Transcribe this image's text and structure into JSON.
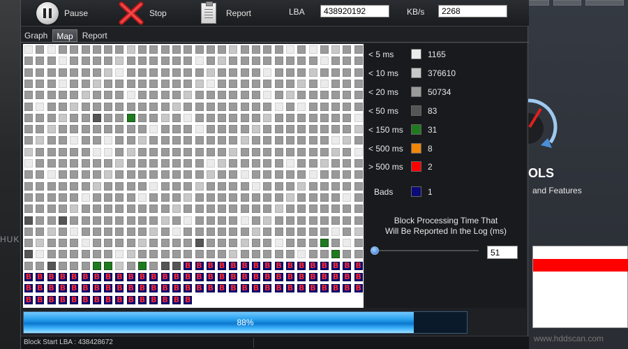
{
  "toolbar": {
    "pause_label": "Pause",
    "stop_label": "Stop",
    "report_label": "Report",
    "lba_label": "LBA",
    "lba_value": "438920192",
    "kbs_label": "KB/s",
    "kbs_value": "2268"
  },
  "tabs": [
    {
      "label": "Graph",
      "active": false
    },
    {
      "label": "Map",
      "active": true
    },
    {
      "label": "Report",
      "active": false
    }
  ],
  "legend": [
    {
      "label": "< 5 ms",
      "color": "#ebebeb",
      "count": "1165"
    },
    {
      "label": "< 10 ms",
      "color": "#c8c8c8",
      "count": "376610"
    },
    {
      "label": "< 20 ms",
      "color": "#9a9a9a",
      "count": "50734"
    },
    {
      "label": "< 50 ms",
      "color": "#555555",
      "count": "83"
    },
    {
      "label": "< 150 ms",
      "color": "#1f7a1f",
      "count": "31"
    },
    {
      "label": "< 500 ms",
      "color": "#f0860a",
      "count": "8"
    },
    {
      "label": "> 500 ms",
      "color": "#ff0000",
      "count": "2"
    },
    {
      "label": "Bads",
      "color": "#0a0a78",
      "count": "1"
    }
  ],
  "threshold": {
    "caption_line1": "Block Processing Time That",
    "caption_line2": "Will Be Reported In the Log (ms)",
    "value": "51"
  },
  "map": {
    "bad_mark": "B"
  },
  "progress": {
    "percent": 88,
    "label": "88%"
  },
  "status": {
    "block_start": "Block Start LBA : 438428672"
  },
  "background": {
    "left_text": "HUK",
    "right_title": "OLS",
    "right_subtitle": "and Features",
    "right_url": "www.hddscan.com"
  }
}
